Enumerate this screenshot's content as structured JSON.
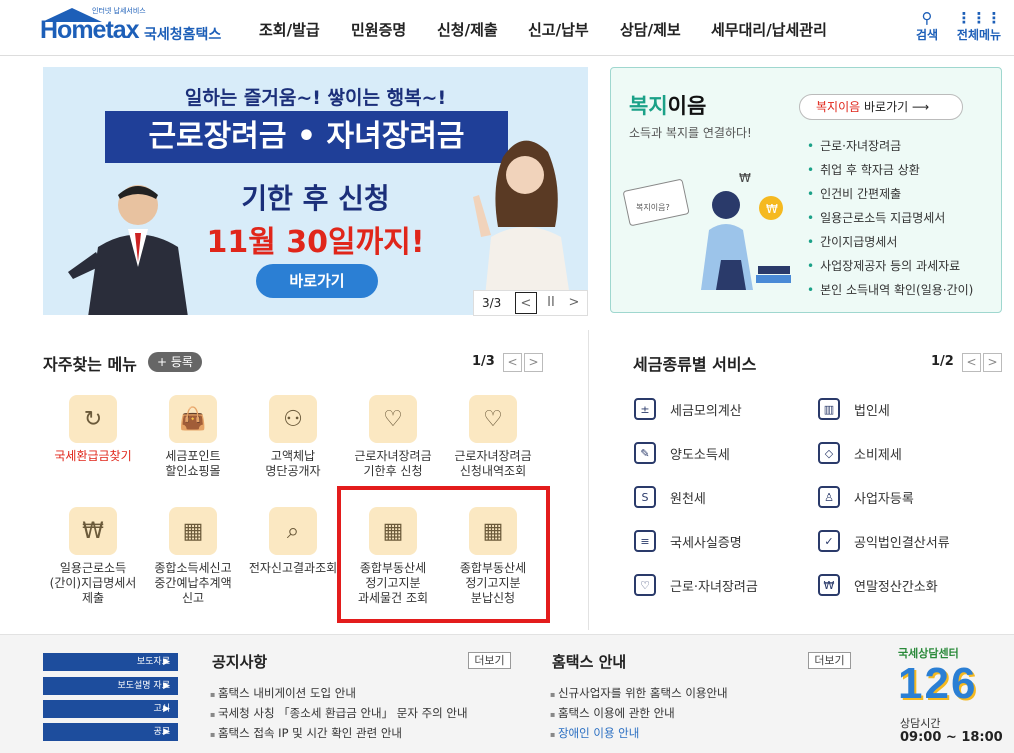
{
  "header": {
    "logo_sub": "인터넷 납세서비스",
    "logo_main": "Hometax",
    "logo_kr": "국세청홈택스",
    "nav": [
      "조회/발급",
      "민원증명",
      "신청/제출",
      "신고/납부",
      "상담/제보",
      "세무대리/납세관리"
    ],
    "search_label": "검색",
    "allmenu_label": "전체메뉴"
  },
  "banner": {
    "line1": "일하는 즐거움~! 쌓이는 행복~!",
    "line2": "근로장려금 • 자녀장려금",
    "line3": "기한 후 신청",
    "line4": "11월 30일까지!",
    "button": "바로가기",
    "page": "3/3",
    "prev": "<",
    "pause": "II",
    "next": ">"
  },
  "welfare": {
    "title_a": "복지",
    "title_b": "이음",
    "subtitle": "소득과 복지를 연결하다!",
    "go_a": "복지이음",
    "go_b": " 바로가기 ⟶",
    "items": [
      "근로·자녀장려금",
      "취업 후 학자금 상환",
      "인건비 간편제출",
      "일용근로소득 지급명세서",
      "간이지급명세서",
      "사업장제공자 등의 과세자료",
      "본인 소득내역 확인(일용·간이)"
    ]
  },
  "frequent": {
    "title": "자주찾는 메뉴",
    "register": "+ 등록",
    "page": "1/3",
    "items": [
      {
        "label": "국세환급금찾기",
        "icon": "refund-icon"
      },
      {
        "label": "세금포인트\n할인쇼핑몰",
        "icon": "shopping-bag-icon"
      },
      {
        "label": "고액체납\n명단공개자",
        "icon": "people-search-icon"
      },
      {
        "label": "근로자녀장려금\n기한후 신청",
        "icon": "heart-hand-icon"
      },
      {
        "label": "근로자녀장려금\n신청내역조회",
        "icon": "heart-hand-icon"
      },
      {
        "label": "일용근로소득\n(간이)지급명세서\n제출",
        "icon": "money-hand-icon"
      },
      {
        "label": "종합소득세신고\n중간예납추계액\n신고",
        "icon": "calendar-icon"
      },
      {
        "label": "전자신고결과조회",
        "icon": "search-doc-icon"
      },
      {
        "label": "종합부동산세\n정기고지분\n과세물건 조회",
        "icon": "calendar-check-icon"
      },
      {
        "label": "종합부동산세\n정기고지분\n분납신청",
        "icon": "calendar-check-icon"
      }
    ]
  },
  "taxservice": {
    "title": "세금종류별 서비스",
    "page": "1/2",
    "left": [
      {
        "label": "세금모의계산",
        "icon": "calculator-icon",
        "g": "±"
      },
      {
        "label": "양도소득세",
        "icon": "document-pen-icon",
        "g": "✎"
      },
      {
        "label": "원천세",
        "icon": "salary-doc-icon",
        "g": "S"
      },
      {
        "label": "국세사실증명",
        "icon": "document-icon",
        "g": "≡"
      },
      {
        "label": "근로·자녀장려금",
        "icon": "heart-hand-icon",
        "g": "♡"
      }
    ],
    "right": [
      {
        "label": "법인세",
        "icon": "building-icon",
        "g": "▥"
      },
      {
        "label": "소비제세",
        "icon": "diamond-icon",
        "g": "◇"
      },
      {
        "label": "사업자등록",
        "icon": "person-icon",
        "g": "♙"
      },
      {
        "label": "공익법인결산서류",
        "icon": "clipboard-icon",
        "g": "✓"
      },
      {
        "label": "연말정산간소화",
        "icon": "won-chat-icon",
        "g": "₩"
      }
    ]
  },
  "footer": {
    "links": [
      "보도자료",
      "보도설명 자료",
      "고시",
      "공고"
    ],
    "notice_title": "공지사항",
    "notice_more": "더보기",
    "notices": [
      "홈택스 내비게이션 도입 안내",
      "국세청 사칭 「종소세 환급금 안내」 문자 주의 안내",
      "홈택스 접속 IP 및 시간 확인 관련 안내"
    ],
    "guide_title": "홈택스 안내",
    "guide_more": "더보기",
    "guides": [
      "신규사업자를 위한 홈택스 이용안내",
      "홈택스 이용에 관한 안내",
      "장애인 이용 안내"
    ],
    "center_title": "국세상담센터",
    "center_number": "126",
    "hours_label": "상담시간",
    "hours": "09:00 ~ 18:00"
  }
}
